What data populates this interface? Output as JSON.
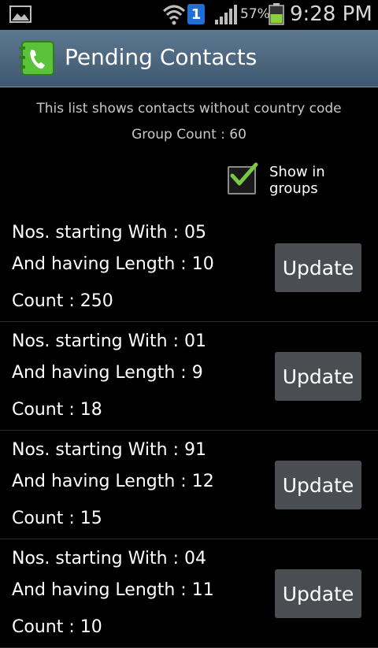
{
  "status_bar": {
    "notification_badge": "1",
    "battery_percent": "57%",
    "time": "9:28 PM"
  },
  "header": {
    "title": "Pending Contacts"
  },
  "info": {
    "description": "This list shows contacts without country code",
    "group_count": "Group Count : 60"
  },
  "group_toggle": {
    "label": "Show in groups",
    "checked": true
  },
  "rows": [
    {
      "starting": "Nos. starting With : 05",
      "length": "And having Length : 10",
      "count": "Count : 250",
      "button": "Update"
    },
    {
      "starting": "Nos. starting With : 01",
      "length": "And having Length : 9",
      "count": "Count : 18",
      "button": "Update"
    },
    {
      "starting": "Nos. starting With : 91",
      "length": "And having Length : 12",
      "count": "Count : 15",
      "button": "Update"
    },
    {
      "starting": "Nos. starting With : 04",
      "length": "And having Length : 11",
      "count": "Count : 10",
      "button": "Update"
    }
  ],
  "colors": {
    "title_bar": "#4e6880",
    "check_mark": "#7ac943",
    "battery_fill": "#8bd13a",
    "button_bg": "#4a4d51"
  }
}
